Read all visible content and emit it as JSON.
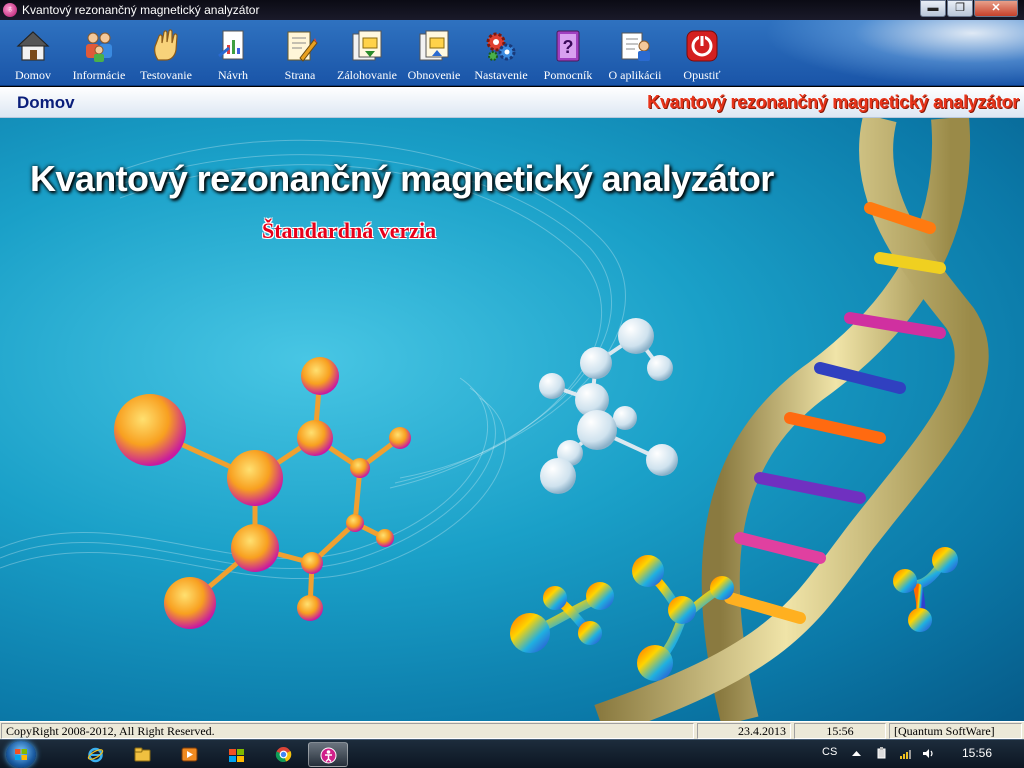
{
  "window": {
    "title": "Kvantový rezonančný magnetický analyzátor",
    "buttons": {
      "minimize": "▬",
      "maximize": "❐",
      "close": "✕"
    }
  },
  "toolbar": {
    "items": [
      {
        "label": "Domov",
        "icon": "home-icon"
      },
      {
        "label": "Informácie",
        "icon": "people-icon"
      },
      {
        "label": "Testovanie",
        "icon": "hand-icon"
      },
      {
        "label": "Návrh",
        "icon": "chart-document-icon"
      },
      {
        "label": "Strana",
        "icon": "edit-page-icon"
      },
      {
        "label": "Zálohovanie",
        "icon": "backup-icon"
      },
      {
        "label": "Obnovenie",
        "icon": "restore-icon"
      },
      {
        "label": "Nastavenie",
        "icon": "gears-icon"
      },
      {
        "label": "Pomocník",
        "icon": "help-book-icon"
      },
      {
        "label": "O aplikácii",
        "icon": "about-icon"
      },
      {
        "label": "Opustiť",
        "icon": "power-icon"
      }
    ]
  },
  "header": {
    "page_name": "Domov",
    "brand": "Kvantový rezonančný magnetický analyzátor"
  },
  "hero": {
    "title": "Kvantový rezonančný magnetický analyzátor",
    "subtitle": "Štandardná verzia"
  },
  "statusbar": {
    "copyright": "CopyRight 2008-2012, All Right Reserved.",
    "date": "23.4.2013",
    "time": "15:56",
    "vendor": "[Quantum SoftWare]"
  },
  "taskbar": {
    "language": "CS",
    "clock": "15:56",
    "apps": [
      "internet-explorer-icon",
      "file-explorer-icon",
      "media-player-icon",
      "windows-update-icon",
      "chrome-icon",
      "analyzer-app-icon"
    ]
  },
  "colors": {
    "toolbar": "#1a55a8",
    "brand_red": "#e8341a",
    "page_name": "#0a1e7a",
    "subtitle_red": "#e8001a"
  }
}
